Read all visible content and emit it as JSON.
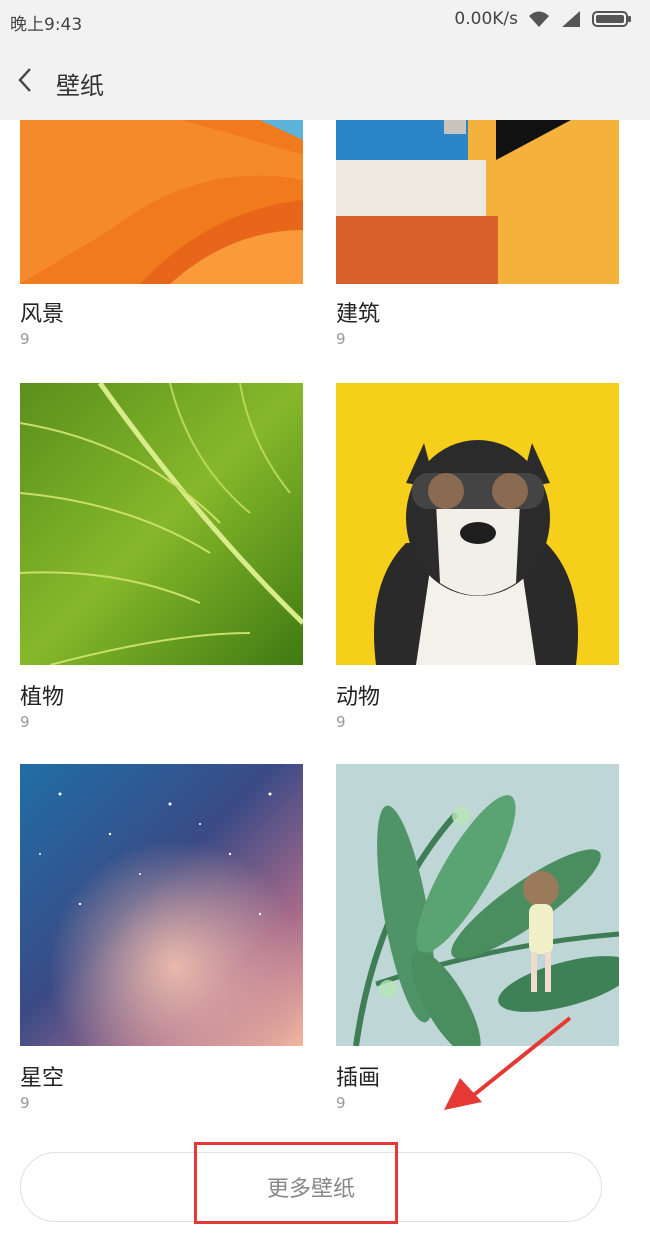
{
  "status_bar": {
    "time": "晚上9:43",
    "net_speed": "0.00K/s",
    "icons": [
      "wifi-icon",
      "signal-icon",
      "battery-icon"
    ]
  },
  "header": {
    "title": "壁纸",
    "back_icon": "chevron-left-icon"
  },
  "categories": [
    {
      "label": "风景",
      "count": "9"
    },
    {
      "label": "建筑",
      "count": "9"
    },
    {
      "label": "植物",
      "count": "9"
    },
    {
      "label": "动物",
      "count": "9"
    },
    {
      "label": "星空",
      "count": "9"
    },
    {
      "label": "插画",
      "count": "9"
    }
  ],
  "more_button": {
    "label": "更多壁纸"
  },
  "colors": {
    "accent_annotation": "#e53935",
    "header_bg": "#f2f2f2"
  }
}
